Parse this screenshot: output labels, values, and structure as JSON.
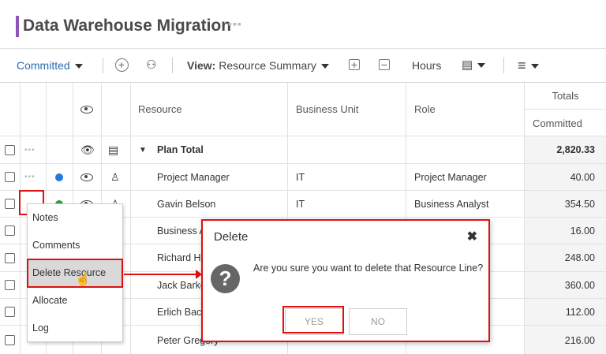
{
  "page": {
    "title": "Data Warehouse Migration"
  },
  "toolbar": {
    "view_mode": "Committed",
    "view_label": "View:",
    "view_value": "Resource Summary",
    "units": "Hours"
  },
  "grid": {
    "headers": {
      "resource": "Resource",
      "business_unit": "Business Unit",
      "role": "Role",
      "totals": "Totals",
      "committed": "Committed"
    },
    "rows": [
      {
        "resource": "Plan Total",
        "business_unit": "",
        "role": "",
        "committed": "2,820.33",
        "status": ""
      },
      {
        "resource": "Project Manager",
        "business_unit": "IT",
        "role": "Project Manager",
        "committed": "40.00",
        "status": "blue"
      },
      {
        "resource": "Gavin Belson",
        "business_unit": "IT",
        "role": "Business Analyst",
        "committed": "354.50",
        "status": "green"
      },
      {
        "resource": "Business A",
        "business_unit": "",
        "role": "",
        "committed": "16.00",
        "status": ""
      },
      {
        "resource": "Richard He",
        "business_unit": "",
        "role": "",
        "committed": "248.00",
        "status": ""
      },
      {
        "resource": "Jack Barke",
        "business_unit": "",
        "role": "",
        "committed": "360.00",
        "status": ""
      },
      {
        "resource": "Erlich Bach",
        "business_unit": "",
        "role": "",
        "committed": "112.00",
        "status": ""
      },
      {
        "resource": "Peter Gregory",
        "business_unit": "",
        "role": "",
        "committed": "216.00",
        "status": ""
      }
    ]
  },
  "context_menu": {
    "items": [
      "Notes",
      "Comments",
      "Delete Resource",
      "Allocate",
      "Log"
    ]
  },
  "dialog": {
    "title": "Delete",
    "close": "✖",
    "message": "Are you sure you want to delete that Resource Line?",
    "yes": "YES",
    "no": "NO",
    "icon": "?"
  },
  "colors": {
    "accent": "#8e55b7",
    "link": "#2b6cb0",
    "highlight": "#dd1111"
  }
}
